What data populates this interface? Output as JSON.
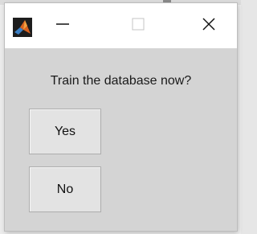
{
  "window": {
    "title_icon": "matlab-logo-icon",
    "controls": {
      "minimize_icon": "minimize-icon",
      "maximize_icon": "maximize-icon",
      "close_icon": "close-icon"
    }
  },
  "dialog": {
    "prompt": "Train the database now?",
    "yes_label": "Yes",
    "no_label": "No"
  }
}
